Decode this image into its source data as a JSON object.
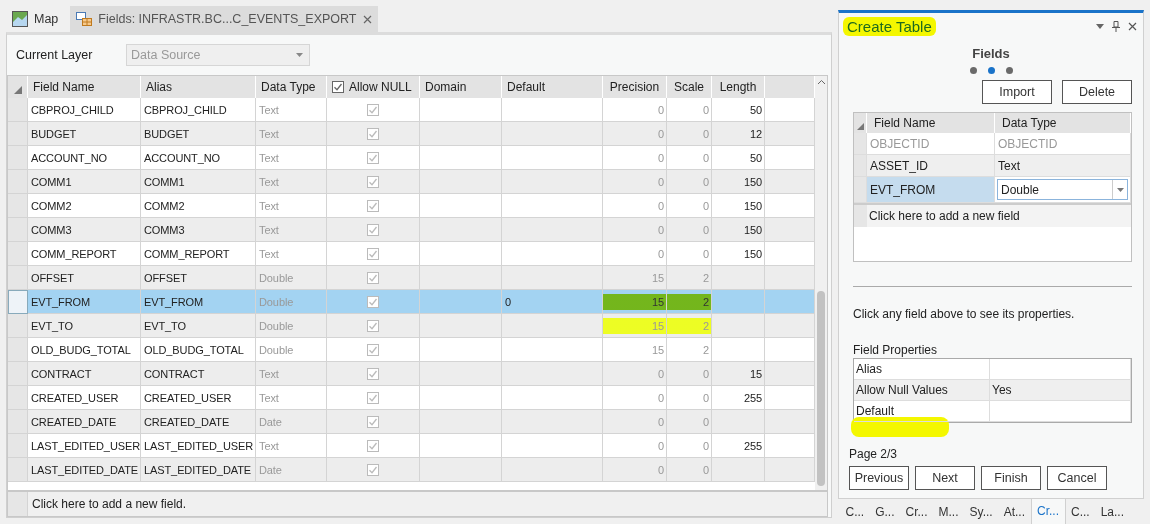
{
  "tabs": [
    {
      "label": "Map",
      "kind": "map",
      "selected": false,
      "closable": false
    },
    {
      "label": "Fields:  INFRASTR.BC...C_EVENTS_EXPORT",
      "kind": "fields",
      "selected": true,
      "closable": true
    }
  ],
  "current_layer": {
    "label": "Current Layer",
    "value": "Data Source",
    "disabled": true
  },
  "fields_table": {
    "columns": [
      {
        "label": "Field Name",
        "kind": "text"
      },
      {
        "label": "Alias",
        "kind": "text"
      },
      {
        "label": "Data Type",
        "kind": "text"
      },
      {
        "label": "Allow NULL",
        "kind": "checkbox",
        "checked": true
      },
      {
        "label": "Domain",
        "kind": "text"
      },
      {
        "label": "Default",
        "kind": "text"
      },
      {
        "label": "Precision",
        "kind": "number"
      },
      {
        "label": "Scale",
        "kind": "number"
      },
      {
        "label": "Length",
        "kind": "number"
      }
    ],
    "rows": [
      {
        "field_name": "CBPROJ_CHILD",
        "alias": "CBPROJ_CHILD",
        "data_type": "Text",
        "allow_null": true,
        "precision": "0",
        "scale": "0",
        "length": "50",
        "selected": false,
        "highlighted": false
      },
      {
        "field_name": "BUDGET",
        "alias": "BUDGET",
        "data_type": "Text",
        "allow_null": true,
        "precision": "0",
        "scale": "0",
        "length": "12",
        "selected": false,
        "highlighted": false
      },
      {
        "field_name": "ACCOUNT_NO",
        "alias": "ACCOUNT_NO",
        "data_type": "Text",
        "allow_null": true,
        "precision": "0",
        "scale": "0",
        "length": "50",
        "selected": false,
        "highlighted": false
      },
      {
        "field_name": "COMM1",
        "alias": "COMM1",
        "data_type": "Text",
        "allow_null": true,
        "precision": "0",
        "scale": "0",
        "length": "150",
        "selected": false,
        "highlighted": false
      },
      {
        "field_name": "COMM2",
        "alias": "COMM2",
        "data_type": "Text",
        "allow_null": true,
        "precision": "0",
        "scale": "0",
        "length": "150",
        "selected": false,
        "highlighted": false
      },
      {
        "field_name": "COMM3",
        "alias": "COMM3",
        "data_type": "Text",
        "allow_null": true,
        "precision": "0",
        "scale": "0",
        "length": "150",
        "selected": false,
        "highlighted": false
      },
      {
        "field_name": "COMM_REPORT",
        "alias": "COMM_REPORT",
        "data_type": "Text",
        "allow_null": true,
        "precision": "0",
        "scale": "0",
        "length": "150",
        "selected": false,
        "highlighted": false
      },
      {
        "field_name": "OFFSET",
        "alias": "OFFSET",
        "data_type": "Double",
        "allow_null": true,
        "precision": "15",
        "scale": "2",
        "selected": false,
        "highlighted": false
      },
      {
        "field_name": "EVT_FROM",
        "alias": "EVT_FROM",
        "data_type": "Double",
        "allow_null": true,
        "default": "0",
        "precision": "15",
        "scale": "2",
        "selected": true,
        "highlighted": true
      },
      {
        "field_name": "EVT_TO",
        "alias": "EVT_TO",
        "data_type": "Double",
        "allow_null": true,
        "precision": "15",
        "scale": "2",
        "selected": false,
        "highlighted": true
      },
      {
        "field_name": "OLD_BUDG_TOTAL",
        "alias": "OLD_BUDG_TOTAL",
        "data_type": "Double",
        "allow_null": true,
        "precision": "15",
        "scale": "2",
        "selected": false,
        "highlighted": false
      },
      {
        "field_name": "CONTRACT",
        "alias": "CONTRACT",
        "data_type": "Text",
        "allow_null": true,
        "precision": "0",
        "scale": "0",
        "length": "15",
        "selected": false,
        "highlighted": false
      },
      {
        "field_name": "CREATED_USER",
        "alias": "CREATED_USER",
        "data_type": "Text",
        "allow_null": true,
        "precision": "0",
        "scale": "0",
        "length": "255",
        "selected": false,
        "highlighted": false
      },
      {
        "field_name": "CREATED_DATE",
        "alias": "CREATED_DATE",
        "data_type": "Date",
        "allow_null": true,
        "precision": "0",
        "scale": "0",
        "selected": false,
        "highlighted": false
      },
      {
        "field_name": "LAST_EDITED_USER",
        "alias": "LAST_EDITED_USER",
        "data_type": "Text",
        "allow_null": true,
        "precision": "0",
        "scale": "0",
        "length": "255",
        "selected": false,
        "highlighted": false
      },
      {
        "field_name": "LAST_EDITED_DATE",
        "alias": "LAST_EDITED_DATE",
        "data_type": "Date",
        "allow_null": true,
        "precision": "0",
        "scale": "0",
        "selected": false,
        "highlighted": false
      }
    ],
    "add_row": "Click here to add a new field."
  },
  "panel": {
    "title": "Create Table",
    "title_highlighted": true,
    "step_title": "Fields",
    "steps": [
      {
        "selected": false
      },
      {
        "selected": true
      },
      {
        "selected": false
      }
    ],
    "buttons": [
      "Import",
      "Delete"
    ],
    "fields_grid": {
      "columns": [
        "Field Name",
        "Data Type"
      ],
      "rows": [
        {
          "field_name": "OBJECTID",
          "data_type": "OBJECTID",
          "kind": "plain",
          "disabled": true,
          "selected": false
        },
        {
          "field_name": "ASSET_ID",
          "data_type": "Text",
          "kind": "plain",
          "disabled": false,
          "selected": false
        },
        {
          "field_name": "EVT_FROM",
          "data_type": "Double",
          "kind": "dropdown",
          "disabled": false,
          "selected": true
        }
      ],
      "add_row": "Click here to add a new field"
    },
    "hint": "Click any field above to see its properties.",
    "properties": {
      "title": "Field Properties",
      "rows": [
        {
          "name": "Alias",
          "highlighted": false
        },
        {
          "name": "Allow Null Values",
          "value": "Yes",
          "highlighted": false
        },
        {
          "name": "Default",
          "highlighted": true
        }
      ]
    },
    "page": "Page 2/3",
    "nav_buttons": [
      "Previous",
      "Next",
      "Finish",
      "Cancel"
    ],
    "bottom_tabs": [
      {
        "label": "C...",
        "selected": false
      },
      {
        "label": "G...",
        "selected": false
      },
      {
        "label": "Cr...",
        "selected": false
      },
      {
        "label": "M...",
        "selected": false
      },
      {
        "label": "Sy...",
        "selected": false
      },
      {
        "label": "At...",
        "selected": false
      },
      {
        "label": "Cr...",
        "selected": true
      },
      {
        "label": "C...",
        "selected": false
      },
      {
        "label": "La...",
        "selected": false
      }
    ]
  }
}
